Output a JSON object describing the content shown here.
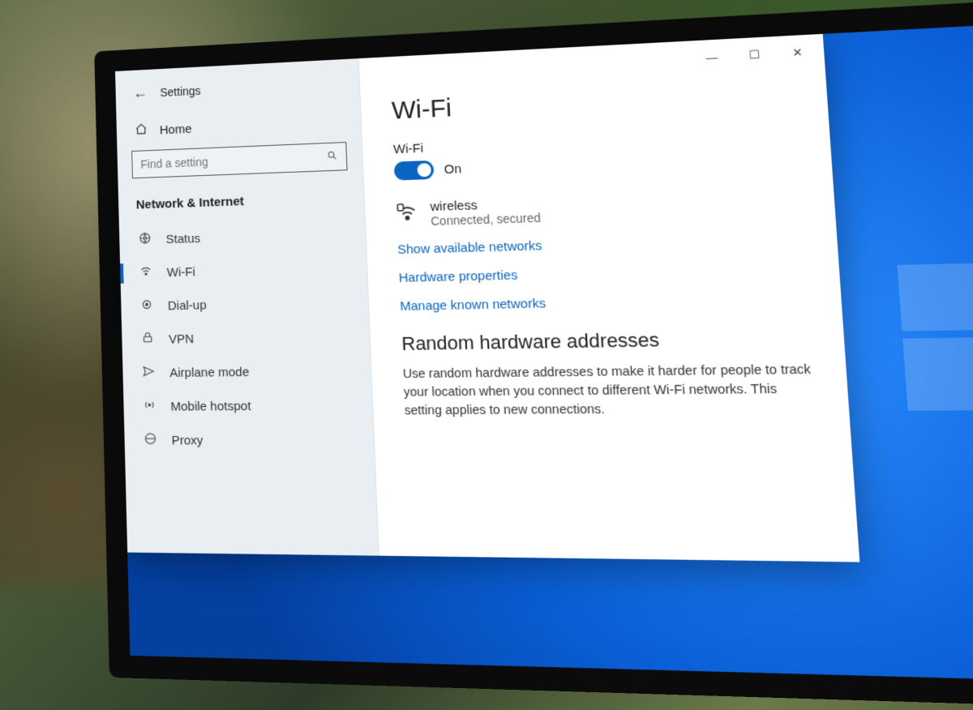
{
  "window": {
    "app_title": "Settings",
    "title_buttons": {
      "min": "—",
      "max": "☐",
      "close": "✕"
    }
  },
  "sidebar": {
    "home": "Home",
    "search_placeholder": "Find a setting",
    "section": "Network & Internet",
    "items": [
      {
        "icon": "globe-icon",
        "label": "Status",
        "active": false
      },
      {
        "icon": "wifi-icon",
        "label": "Wi-Fi",
        "active": true
      },
      {
        "icon": "dialup-icon",
        "label": "Dial-up",
        "active": false
      },
      {
        "icon": "vpn-icon",
        "label": "VPN",
        "active": false
      },
      {
        "icon": "airplane-icon",
        "label": "Airplane mode",
        "active": false
      },
      {
        "icon": "hotspot-icon",
        "label": "Mobile hotspot",
        "active": false
      },
      {
        "icon": "proxy-icon",
        "label": "Proxy",
        "active": false
      }
    ]
  },
  "page": {
    "title": "Wi-Fi",
    "toggle_label": "Wi-Fi",
    "toggle_on": true,
    "toggle_state": "On",
    "network": {
      "name": "wireless",
      "status": "Connected, secured"
    },
    "links": {
      "show": "Show available networks",
      "hw": "Hardware properties",
      "manage": "Manage known networks"
    },
    "random_section": {
      "heading": "Random hardware addresses",
      "desc": "Use random hardware addresses to make it harder for people to track your location when you connect to different Wi-Fi networks. This setting applies to new connections."
    }
  },
  "colors": {
    "accent": "#0a64c2"
  }
}
